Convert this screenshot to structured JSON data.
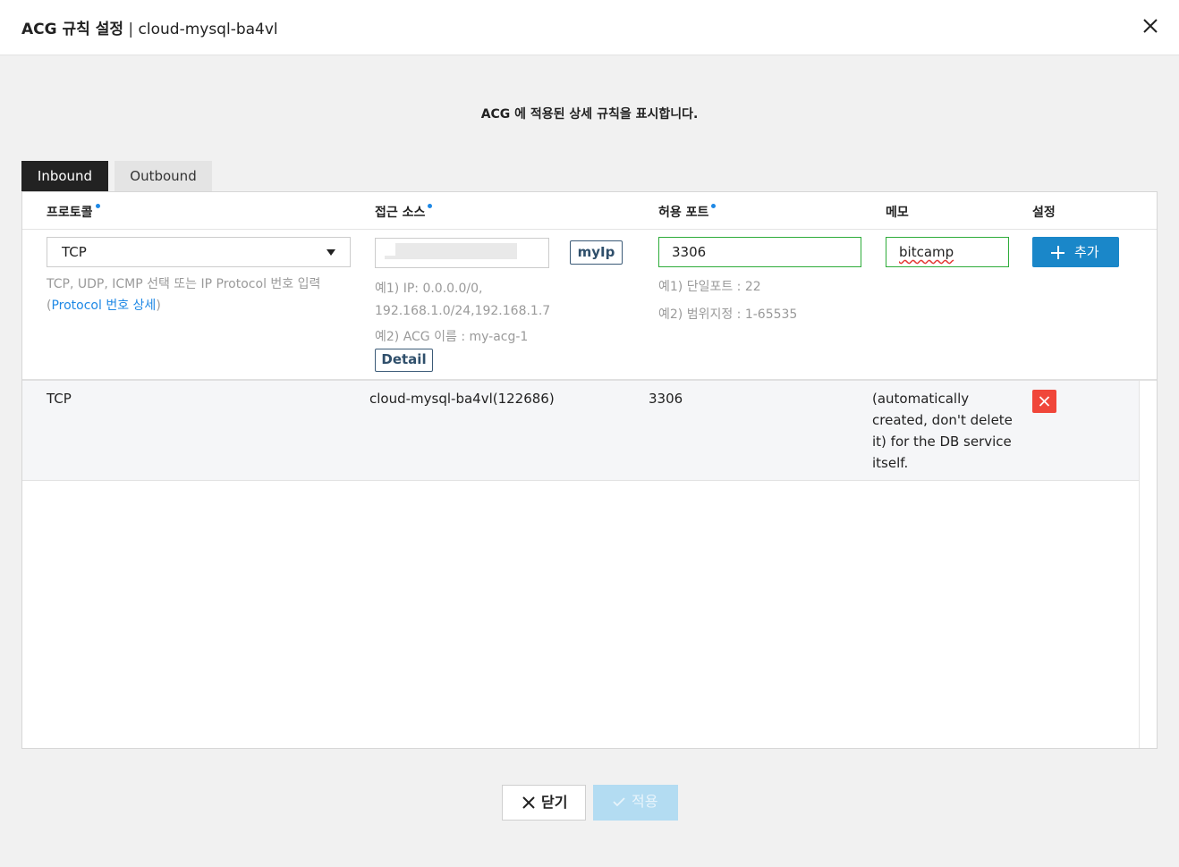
{
  "dialog": {
    "title_bold": "ACG 규칙 설정",
    "title_separator": " | ",
    "title_name": "cloud-mysql-ba4vl"
  },
  "description": "ACG 에 적용된 상세 규칙을 표시합니다.",
  "tabs": [
    {
      "label": "Inbound",
      "active": true
    },
    {
      "label": "Outbound",
      "active": false
    }
  ],
  "columns": {
    "protocol": "프로토콜",
    "source": "접근 소스",
    "port": "허용 포트",
    "memo": "메모",
    "settings": "설정"
  },
  "form": {
    "protocol_value": "TCP",
    "protocol_hint_line1": "TCP, UDP, ICMP 선택 또는 IP Protocol 번호 입력",
    "protocol_hint_paren_open": "(",
    "protocol_hint_link": "Protocol 번호 상세",
    "protocol_hint_paren_close": ")",
    "myip_label": "myIp",
    "source_hint_line1": "예1) IP: 0.0.0.0/0,",
    "source_hint_line2": "192.168.1.0/24,192.168.1.7",
    "source_hint_line3": "예2) ACG 이름 : my-acg-1",
    "detail_label": "Detail",
    "port_value": "3306",
    "port_hint_line1": "예1) 단일포트 : 22",
    "port_hint_line2": "예2) 범위지정 : 1-65535",
    "memo_value": "bitcamp",
    "add_label": "추가"
  },
  "rules": [
    {
      "protocol": "TCP",
      "source": "cloud-mysql-ba4vl(122686)",
      "port": "3306",
      "memo_lines": [
        "(automatically",
        "created, don't delete",
        "it) for the DB service",
        "itself."
      ]
    }
  ],
  "footer": {
    "close_label": "닫기",
    "apply_label": "적용"
  },
  "colors": {
    "accent": "#1a87c9",
    "valid_border": "#2eac3a",
    "delete": "#f0463a",
    "required_dot": "#1e88e5"
  }
}
